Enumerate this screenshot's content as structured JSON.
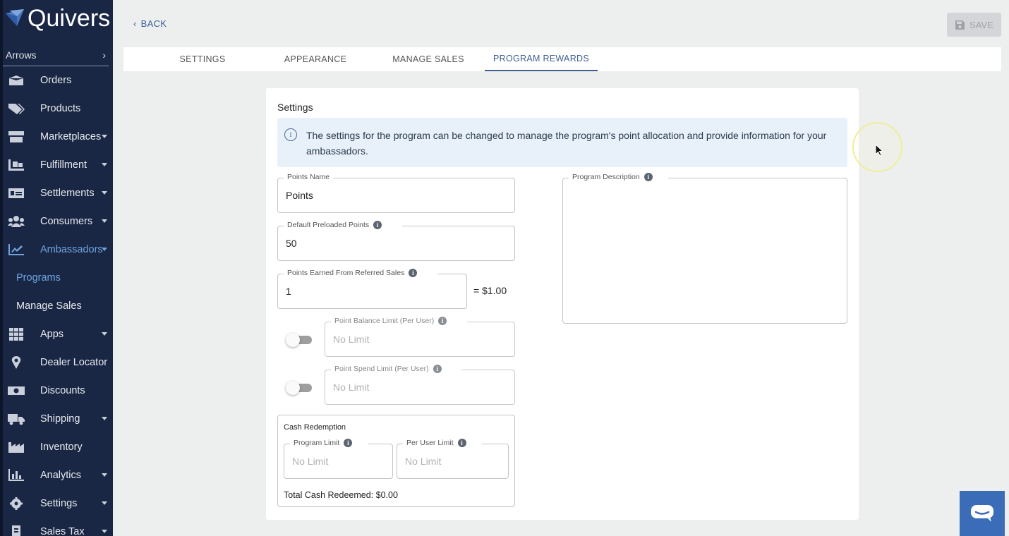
{
  "app": {
    "logo_text": "Quivers"
  },
  "sidebar": {
    "store": "Arrows",
    "items": [
      {
        "label": "Orders",
        "icon": "box-icon"
      },
      {
        "label": "Products",
        "icon": "tag-icon"
      },
      {
        "label": "Marketplaces",
        "icon": "store-icon"
      },
      {
        "label": "Fulfillment",
        "icon": "dolly-icon"
      },
      {
        "label": "Settlements",
        "icon": "money-icon"
      },
      {
        "label": "Consumers",
        "icon": "users-icon"
      },
      {
        "label": "Ambassadors",
        "icon": "chart-line-icon"
      },
      {
        "label": "Programs"
      },
      {
        "label": "Manage Sales"
      },
      {
        "label": "Apps",
        "icon": "grid-icon"
      },
      {
        "label": "Dealer Locator",
        "icon": "map-pin-icon"
      },
      {
        "label": "Discounts",
        "icon": "cash-icon"
      },
      {
        "label": "Shipping",
        "icon": "truck-icon"
      },
      {
        "label": "Inventory",
        "icon": "factory-icon"
      },
      {
        "label": "Analytics",
        "icon": "bar-chart-icon"
      },
      {
        "label": "Settings",
        "icon": "gear-icon"
      },
      {
        "label": "Sales Tax",
        "icon": "receipt-icon"
      }
    ]
  },
  "header": {
    "back_label": "BACK",
    "save_label": "SAVE"
  },
  "tabs": [
    {
      "label": "SETTINGS"
    },
    {
      "label": "APPEARANCE"
    },
    {
      "label": "MANAGE SALES"
    },
    {
      "label": "PROGRAM REWARDS"
    }
  ],
  "card": {
    "title": "Settings",
    "info_text": "The settings for the program can be changed to manage the program's point allocation and provide information for your ambassadors.",
    "points_name": {
      "label": "Points Name",
      "value": "Points"
    },
    "default_preloaded": {
      "label": "Default Preloaded Points",
      "value": "50"
    },
    "points_earned": {
      "label": "Points Earned From Referred Sales",
      "value": "1",
      "equals": "= $1.00"
    },
    "balance_limit": {
      "label": "Point Balance Limit (Per User)",
      "placeholder": "No Limit"
    },
    "spend_limit": {
      "label": "Point Spend Limit (Per User)",
      "placeholder": "No Limit"
    },
    "cash_redemption": {
      "title": "Cash Redemption",
      "program_limit": {
        "label": "Program Limit",
        "placeholder": "No Limit"
      },
      "per_user_limit": {
        "label": "Per User Limit",
        "placeholder": "No Limit"
      },
      "total": "Total Cash Redeemed: $0.00"
    },
    "program_description": {
      "label": "Program Description"
    }
  },
  "colors": {
    "sidebar_bg": "#1a2744",
    "accent": "#3d5e8e",
    "active_nav": "#6ea3e0",
    "chat_button": "#3b6cb8"
  }
}
